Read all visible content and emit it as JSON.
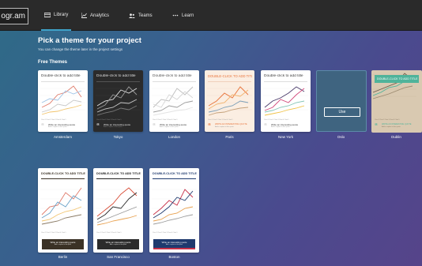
{
  "app": {
    "logo_text": "ogr.am",
    "nav": [
      {
        "label": "Library",
        "icon": "library-icon",
        "active": true
      },
      {
        "label": "Analytics",
        "icon": "analytics-icon",
        "active": false
      },
      {
        "label": "Teams",
        "icon": "teams-icon",
        "active": false
      },
      {
        "label": "Learn",
        "icon": "learn-icon",
        "active": false
      }
    ]
  },
  "page": {
    "title": "Pick a theme for your project",
    "subtitle": "You can change the theme later in the project settings",
    "section_title": "Free Themes"
  },
  "themes": [
    {
      "name": "Amsterdam",
      "title": "Double-click to add title",
      "quote": "Write an interesting quote",
      "quote_sub": "Add a caption to this quote",
      "legend": "Chart 1  Chart 2  Chart 3  Chart 4  Chart 5"
    },
    {
      "name": "Tokyo",
      "title": "Double-click to add title",
      "quote": "Write an interesting quote",
      "quote_sub": "Add a caption to this quote",
      "legend": "Chart 1  Chart 2  Chart 3  Chart 4  Chart 5"
    },
    {
      "name": "London",
      "title": "Double-click to add title",
      "quote": "Write an interesting quote",
      "quote_sub": "Add a caption to this quote",
      "legend": "Chart 1  Chart 2  Chart 3  Chart 4  Chart 5"
    },
    {
      "name": "Paris",
      "title": "DOUBLE-CLICK TO ADD TITLE",
      "quote": "WRITE AN INTERESTING QUOTE",
      "quote_sub": "Add a caption to this quote",
      "legend": "Chart 1  Chart 2  Chart 3  Chart 4  Chart 5"
    },
    {
      "name": "New York",
      "title": "Double-click to add title",
      "quote": "Write an interesting quote",
      "quote_sub": "Add a caption to this quote",
      "legend": "Chart 1  Chart 2  Chart 3  Chart 4  Chart 5"
    },
    {
      "name": "Oslo",
      "use_label": "Use"
    },
    {
      "name": "Dublin",
      "title": "DOUBLE-CLICK TO ADD TITLE",
      "quote": "WRITE AN INTERESTING QUOTE",
      "quote_sub": "Add a caption to this quote",
      "legend": "Chart 1  Chart 2  Chart 3  Chart 4  Chart 5"
    },
    {
      "name": "Berlin",
      "title": "DOUBLE-CLICK TO ADD TITLE",
      "quote": "Write an interesting quote",
      "quote_sub": "Add a caption to this quote",
      "legend": "Chart 1  Chart 2  Chart 3  Chart 4  Chart 5"
    },
    {
      "name": "San Francisco",
      "title": "DOUBLE-CLICK TO ADD TITLE",
      "quote": "Write an interesting quote",
      "quote_sub": "Add a caption to this quote",
      "legend": "Chart 1  Chart 2  Chart 3  Chart 4  Chart 5"
    },
    {
      "name": "Boston",
      "title": "DOUBLE-CLICK TO ADD TITLE",
      "quote": "Write an interesting quote",
      "quote_sub": "Add a caption to this quote",
      "legend": "Chart 1  Chart 2  Chart 3  Chart 4  Chart 5"
    }
  ],
  "colors": {
    "accent": "#3fa2c8",
    "topbar": "#2a2a2a",
    "tokyo_bg": "#2b2b2b",
    "paris_bg": "#fbeee2",
    "paris_accent": "#e8743b",
    "dublin_bg": "#d9c9b1",
    "dublin_header": "#4fb39a",
    "boston_accent": "#1f3a6e",
    "berlin_quote_bg": "#3b3226"
  }
}
